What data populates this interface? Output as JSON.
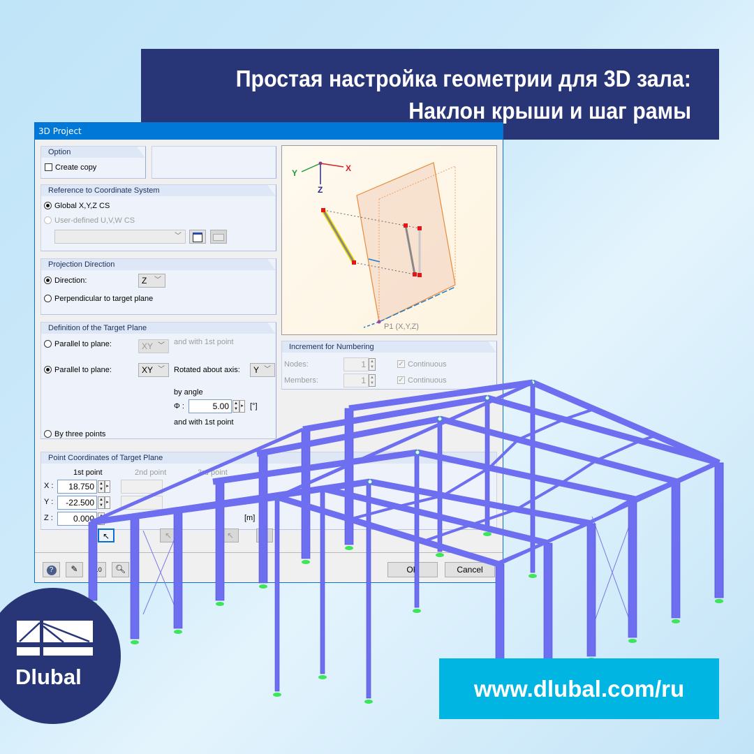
{
  "banner": {
    "title_line1": "Простая настройка геометрии для 3D зала:",
    "title_line2": "Наклон крыши и шаг рамы"
  },
  "dialog": {
    "title": "3D Project",
    "option": {
      "heading": "Option",
      "create_copy_label": "Create copy",
      "create_copy_checked": false
    },
    "coordinate_system": {
      "heading": "Reference to Coordinate System",
      "global_label": "Global X,Y,Z CS",
      "global_selected": true,
      "user_defined_label": "User-defined U,V,W CS",
      "user_defined_selected": false,
      "cs_select_value": "",
      "new_cs_icon": "new-coordinate-system-icon",
      "edit_cs_icon": "edit-coordinate-system-icon"
    },
    "projection": {
      "heading": "Projection Direction",
      "direction_label": "Direction:",
      "direction_selected": true,
      "direction_value": "Z",
      "perpendicular_label": "Perpendicular to target plane",
      "perpendicular_selected": false
    },
    "target_plane": {
      "heading": "Definition of the Target Plane",
      "parallel1_label": "Parallel to plane:",
      "parallel1_selected": false,
      "parallel1_plane": "XY",
      "parallel1_suffix": "and with 1st point",
      "parallel2_label": "Parallel to plane:",
      "parallel2_selected": true,
      "parallel2_plane": "XY",
      "rotated_label": "Rotated about axis:",
      "rotated_axis": "Y",
      "by_angle_label": "by angle",
      "phi_label": "Φ :",
      "phi_value": "5.00",
      "phi_unit": "[°]",
      "with_point_label": "and with 1st point",
      "three_points_label": "By three points",
      "three_points_selected": false
    },
    "point_coordinates": {
      "heading": "Point Coordinates of Target Plane",
      "columns": [
        "1st point",
        "2nd point",
        "3rd point"
      ],
      "rows": [
        {
          "label": "X :",
          "values": [
            "18.750",
            "",
            ""
          ]
        },
        {
          "label": "Y :",
          "values": [
            "-22.500",
            "",
            ""
          ]
        },
        {
          "label": "Z :",
          "values": [
            "0.000",
            "",
            ""
          ]
        }
      ],
      "unit": "[m]"
    },
    "preview": {
      "axis_x": "X",
      "axis_y": "Y",
      "axis_z": "Z",
      "point_label": "P1 (X,Y,Z)"
    },
    "numbering": {
      "heading": "Increment for Numbering",
      "nodes_label": "Nodes:",
      "nodes_value": "1",
      "nodes_continuous_label": "Continuous",
      "members_label": "Members:",
      "members_value": "1",
      "members_continuous_label": "Continuous"
    },
    "footer": {
      "ok_label": "OK",
      "cancel_label": "Cancel",
      "icons": [
        "help-icon",
        "edit-icon",
        "units-icon",
        "view-icon"
      ]
    }
  },
  "logo": {
    "text": "Dlubal"
  },
  "url_banner": {
    "text": "www.dlubal.com/ru"
  },
  "colors": {
    "banner_navy": "#283577",
    "url_cyan": "#00b5e1",
    "dialog_titlebar": "#0078d7",
    "steel_member": "#6e6ef0",
    "support_green": "#3ee45a"
  }
}
